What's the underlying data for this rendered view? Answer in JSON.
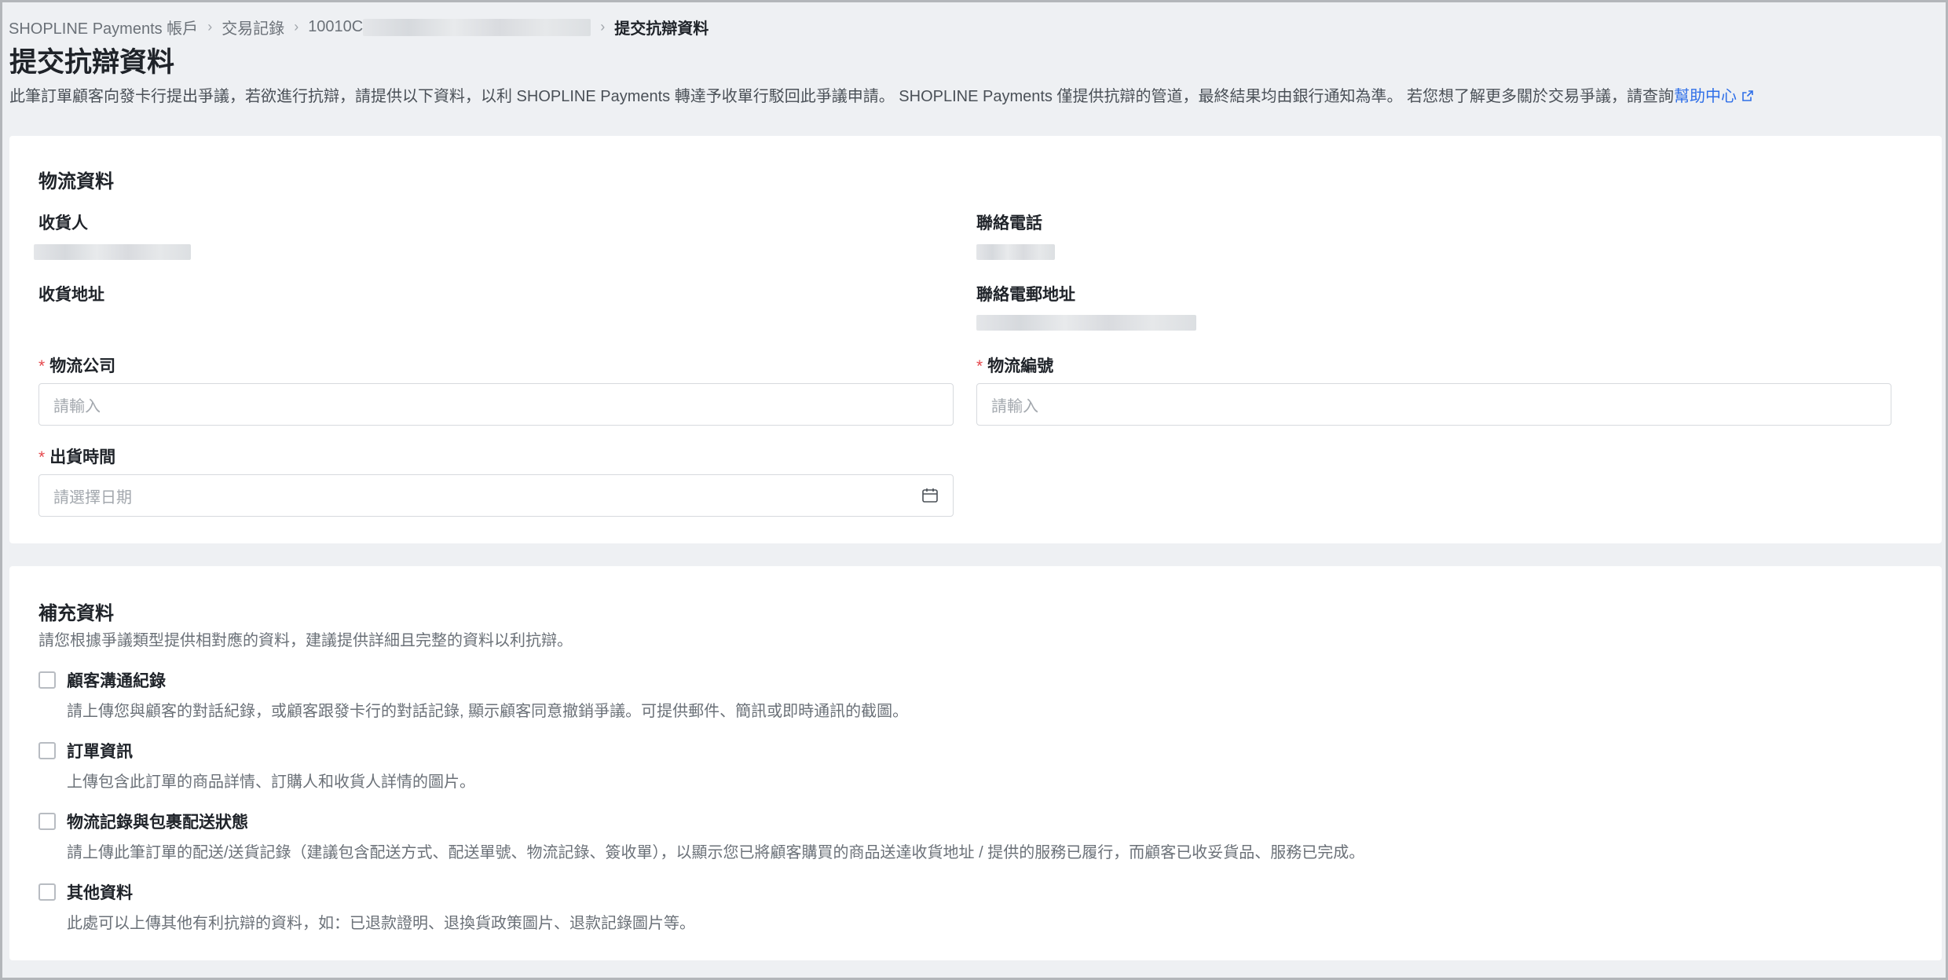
{
  "breadcrumb": {
    "items": [
      "SHOPLINE Payments 帳戶",
      "交易記錄",
      "10010C"
    ],
    "current": "提交抗辯資料"
  },
  "page": {
    "title": "提交抗辯資料",
    "description": "此筆訂單顧客向發卡行提出爭議，若欲進行抗辯，請提供以下資料，以利 SHOPLINE Payments 轉達予收單行駁回此爭議申請。 SHOPLINE Payments 僅提供抗辯的管道，最終結果均由銀行通知為準。 若您想了解更多關於交易爭議，請查詢",
    "help_link": "幫助中心"
  },
  "logistics": {
    "title": "物流資料",
    "recipient_label": "收貨人",
    "phone_label": "聯絡電話",
    "address_label": "收貨地址",
    "email_label": "聯絡電郵地址",
    "carrier_label": "物流公司",
    "carrier_placeholder": "請輸入",
    "tracking_label": "物流編號",
    "tracking_placeholder": "請輸入",
    "ship_date_label": "出貨時間",
    "ship_date_placeholder": "請選擇日期",
    "required_mark": "*"
  },
  "supplement": {
    "title": "補充資料",
    "subtitle": "請您根據爭議類型提供相對應的資料，建議提供詳細且完整的資料以利抗辯。",
    "options": [
      {
        "label": "顧客溝通紀錄",
        "desc": "請上傳您與顧客的對話紀錄，或顧客跟發卡行的對話記錄, 顯示顧客同意撤銷爭議。可提供郵件、簡訊或即時通訊的截圖。",
        "checked": false
      },
      {
        "label": "訂單資訊",
        "desc": "上傳包含此訂單的商品詳情、訂購人和收貨人詳情的圖片。",
        "checked": false
      },
      {
        "label": "物流記錄與包裹配送狀態",
        "desc": "請上傳此筆訂單的配送/送貨記錄（建議包含配送方式、配送單號、物流記錄、簽收單），以顯示您已將顧客購買的商品送達收貨地址 / 提供的服務已履行，而顧客已收妥貨品、服務已完成。",
        "checked": false
      },
      {
        "label": "其他資料",
        "desc": "此處可以上傳其他有利抗辯的資料，如：已退款證明、退換貨政策圖片、退款記錄圖片等。",
        "checked": false
      }
    ]
  },
  "colors": {
    "accent": "#2f6fe8",
    "required": "#e5484d",
    "background": "#eef0f3"
  }
}
